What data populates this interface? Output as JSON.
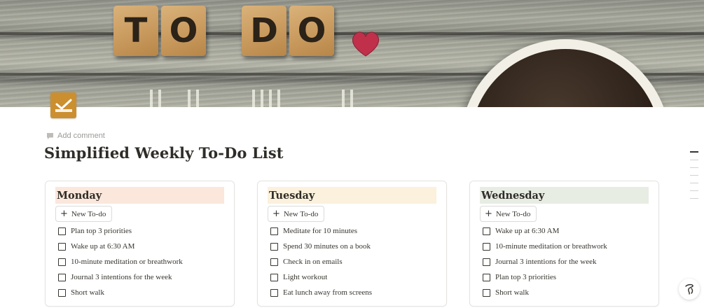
{
  "cover": {
    "tiles": [
      "T",
      "O",
      "D",
      "O"
    ],
    "image_icons": [
      "heart-icon",
      "coffee-cup"
    ]
  },
  "page_icon": "checkmark-icon",
  "add_comment": {
    "icon": "comment-icon",
    "label": "Add comment"
  },
  "page_title": "Simplified Weekly To-Do List",
  "columns": [
    {
      "day": "Monday",
      "header_color": "#fbe7dc",
      "new_label": "New To-do",
      "todos": [
        "Plan top 3 priorities",
        "Wake up at 6:30 AM",
        "10-minute meditation or breathwork",
        "Journal 3 intentions for the week",
        "Short walk"
      ]
    },
    {
      "day": "Tuesday",
      "header_color": "#fbf1dc",
      "new_label": "New To-do",
      "todos": [
        "Meditate for 10 minutes",
        "Spend 30 minutes on a book",
        "Check in on emails",
        "Light workout",
        "Eat lunch away from screens"
      ]
    },
    {
      "day": "Wednesday",
      "header_color": "#e8ede4",
      "new_label": "New To-do",
      "todos": [
        "Wake up at 6:30 AM",
        "10-minute meditation or breathwork",
        "Journal 3 intentions for the week",
        "Plan top 3 priorities",
        "Short walk"
      ]
    }
  ],
  "colors": {
    "page_icon_bg": "#cc8f2f",
    "heart": "#c0304a"
  },
  "help_button": {
    "icon": "scribble-help-icon"
  }
}
